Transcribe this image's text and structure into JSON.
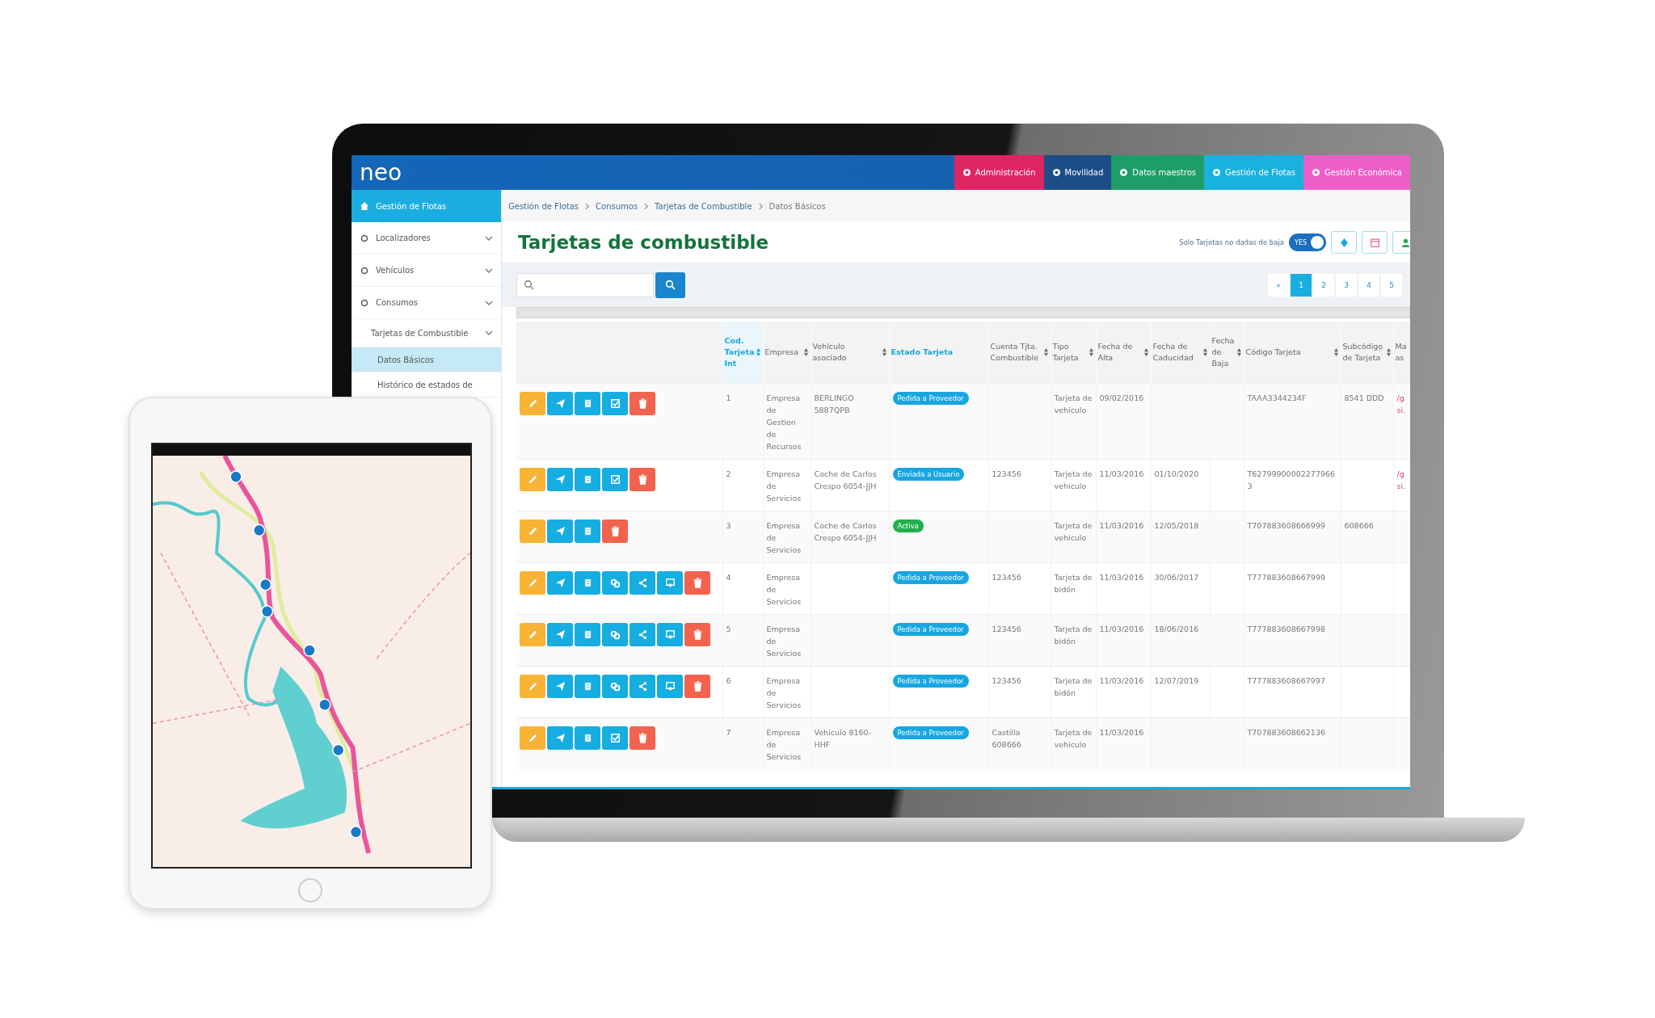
{
  "app": {
    "logo": "neo"
  },
  "modules": [
    {
      "label": "Administración",
      "color": "#df2462"
    },
    {
      "label": "Movilidad",
      "color": "#1d4d86"
    },
    {
      "label": "Datos maestros",
      "color": "#1e9d68"
    },
    {
      "label": "Gestión de Flotas",
      "color": "#19b1de"
    },
    {
      "label": "Gestión Económica",
      "color": "#ee5ec7"
    }
  ],
  "sidebar": {
    "title": "Gestión de Flotas",
    "items": [
      {
        "label": "Localizadores",
        "selected": false
      },
      {
        "label": "Vehículos",
        "selected": false
      },
      {
        "label": "Consumos",
        "selected": false,
        "children": [
          {
            "label": "Tarjetas de Combustible",
            "selected": false,
            "children": [
              {
                "label": "Datos Básicos",
                "selected": true
              },
              {
                "label": "Histórico de estados de",
                "selected": false
              }
            ]
          }
        ]
      }
    ]
  },
  "breadcrumb": [
    "Gestión de Flotas",
    "Consumos",
    "Tarjetas de Combustible",
    "Datos Básicos"
  ],
  "page_title": "Tarjetas de combustible",
  "toggle": {
    "label": "Solo Tarjetas no dadas de baja",
    "text": "YES",
    "on": true
  },
  "pagination": [
    {
      "label": "«",
      "selected": false
    },
    {
      "label": "1",
      "selected": true
    },
    {
      "label": "2",
      "selected": false
    },
    {
      "label": "3",
      "selected": false
    },
    {
      "label": "4",
      "selected": false
    },
    {
      "label": "5",
      "selected": false
    }
  ],
  "table": {
    "columns": [
      {
        "label": "Cod. Tarjeta Int",
        "sortable": true,
        "active": true,
        "kind": "text"
      },
      {
        "label": "Empresa",
        "sortable": true,
        "active": false,
        "kind": "text"
      },
      {
        "label": "Vehículo asociado",
        "sortable": true,
        "active": false,
        "kind": "text"
      },
      {
        "label": "Estado Tarjeta",
        "sortable": false,
        "active": true,
        "kind": "status"
      },
      {
        "label": "Cuenta Tjta. Combustible",
        "sortable": true,
        "active": false,
        "kind": "text"
      },
      {
        "label": "Tipo Tarjeta",
        "sortable": true,
        "active": false,
        "kind": "text"
      },
      {
        "label": "Fecha de Alta",
        "sortable": true,
        "active": false,
        "kind": "text"
      },
      {
        "label": "Fecha de Caducidad",
        "sortable": true,
        "active": false,
        "kind": "text"
      },
      {
        "label": "Fecha de Baja",
        "sortable": true,
        "active": false,
        "kind": "text"
      },
      {
        "label": "Código Tarjeta",
        "sortable": true,
        "active": false,
        "kind": "text"
      },
      {
        "label": "Subcódigo de Tarjeta",
        "sortable": true,
        "active": false,
        "kind": "text"
      },
      {
        "label": "Ma as",
        "sortable": false,
        "active": false,
        "kind": "link"
      }
    ],
    "rows": [
      {
        "actions": [
          {
            "kind": "edit"
          },
          {
            "kind": "send"
          },
          {
            "kind": "document"
          },
          {
            "kind": "check"
          },
          {
            "kind": "delete"
          }
        ],
        "status": {
          "label": "Pedida a Proveedor",
          "color": "#17a6e0"
        },
        "cells": [
          "1",
          "Empresa de Gestion de Recursos",
          "BERLINGO 5887QPB",
          null,
          null,
          "Tarjeta de vehiculo",
          "09/02/2016",
          null,
          null,
          "TAAA3344234F",
          "8541 DDD",
          "/g si."
        ]
      },
      {
        "actions": [
          {
            "kind": "edit"
          },
          {
            "kind": "send"
          },
          {
            "kind": "document"
          },
          {
            "kind": "check"
          },
          {
            "kind": "delete"
          }
        ],
        "status": {
          "label": "Enviada a Usuario",
          "color": "#17a6e0"
        },
        "cells": [
          "2",
          "Empresa de Servicios",
          "Coche de Carlos Crespo 6054-JJH",
          null,
          "123456",
          "Tarjeta de vehiculo",
          "11/03/2016",
          "01/10/2020",
          null,
          "T627999000022779663",
          null,
          "/g si."
        ]
      },
      {
        "actions": [
          {
            "kind": "edit"
          },
          {
            "kind": "send"
          },
          {
            "kind": "document"
          },
          {
            "kind": "delete"
          }
        ],
        "status": {
          "label": "Activa",
          "color": "#1fb04c"
        },
        "cells": [
          "3",
          "Empresa de Servicios",
          "Coche de Carlos Crespo 6054-JJH",
          null,
          null,
          "Tarjeta de vehiculo",
          "11/03/2016",
          "12/05/2018",
          null,
          "T707883608666999",
          "608666",
          null
        ]
      },
      {
        "actions": [
          {
            "kind": "edit"
          },
          {
            "kind": "send"
          },
          {
            "kind": "document"
          },
          {
            "kind": "link"
          },
          {
            "kind": "share"
          },
          {
            "kind": "certify"
          },
          {
            "kind": "delete"
          }
        ],
        "status": {
          "label": "Pedida a Proveedor",
          "color": "#17a6e0"
        },
        "cells": [
          "4",
          "Empresa de Servicios",
          null,
          null,
          "123456",
          "Tarjeta de bidón",
          "11/03/2016",
          "30/06/2017",
          null,
          "T777883608667999",
          null,
          null
        ]
      },
      {
        "actions": [
          {
            "kind": "edit"
          },
          {
            "kind": "send"
          },
          {
            "kind": "document"
          },
          {
            "kind": "link"
          },
          {
            "kind": "share"
          },
          {
            "kind": "certify"
          },
          {
            "kind": "delete"
          }
        ],
        "status": {
          "label": "Pedida a Proveedor",
          "color": "#17a6e0"
        },
        "cells": [
          "5",
          "Empresa de Servicios",
          null,
          null,
          "123456",
          "Tarjeta de bidón",
          "11/03/2016",
          "18/06/2016",
          null,
          "T777883608667998",
          null,
          null
        ]
      },
      {
        "actions": [
          {
            "kind": "edit"
          },
          {
            "kind": "send"
          },
          {
            "kind": "document"
          },
          {
            "kind": "link"
          },
          {
            "kind": "share"
          },
          {
            "kind": "certify"
          },
          {
            "kind": "delete"
          }
        ],
        "status": {
          "label": "Pedida a Proveedor",
          "color": "#17a6e0"
        },
        "cells": [
          "6",
          "Empresa de Servicios",
          null,
          null,
          "123456",
          "Tarjeta de bidón",
          "11/03/2016",
          "12/07/2019",
          null,
          "T777883608667997",
          null,
          null
        ]
      },
      {
        "actions": [
          {
            "kind": "edit"
          },
          {
            "kind": "send"
          },
          {
            "kind": "document"
          },
          {
            "kind": "check"
          },
          {
            "kind": "delete"
          }
        ],
        "status": {
          "label": "Pedida a Proveedor",
          "color": "#17a6e0"
        },
        "cells": [
          "7",
          "Empresa de Servicios",
          "Vehiculo 8160-HHF",
          null,
          "Castilla 608666",
          "Tarjeta de vehiculo",
          "11/03/2016",
          null,
          null,
          "T707883608662136",
          null,
          null
        ]
      }
    ]
  },
  "tablet": {
    "screen": {
      "kind": "picture"
    }
  }
}
